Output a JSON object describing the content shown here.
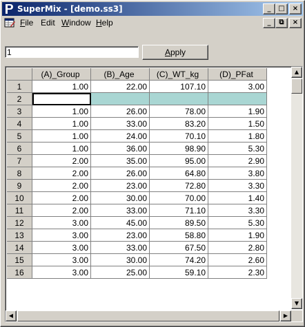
{
  "window": {
    "title": "SuperMix - [demo.ss3]",
    "controls": {
      "minimize": "_",
      "maximize": "□",
      "close": "×"
    }
  },
  "menu": {
    "items": [
      {
        "label": "File",
        "mnemonic": "F"
      },
      {
        "label": "Edit"
      },
      {
        "label": "Window",
        "mnemonic": "W"
      },
      {
        "label": "Help",
        "mnemonic": "H"
      }
    ],
    "mdi_controls": {
      "minimize": "_",
      "restore": "⧉",
      "close": "×"
    }
  },
  "toolbar": {
    "cell_value": "1",
    "apply_label": "Apply",
    "apply_mnemonic": "A"
  },
  "grid": {
    "columns": [
      "(A)_Group",
      "(B)_Age",
      "(C)_WT_kg",
      "(D)_PFat"
    ],
    "selected_row": 2,
    "rows": [
      {
        "n": "1",
        "cells": [
          "1.00",
          "22.00",
          "107.10",
          "3.00"
        ]
      },
      {
        "n": "2",
        "cells": [
          "",
          "",
          "",
          ""
        ]
      },
      {
        "n": "3",
        "cells": [
          "1.00",
          "26.00",
          "78.00",
          "1.90"
        ]
      },
      {
        "n": "4",
        "cells": [
          "1.00",
          "33.00",
          "83.20",
          "1.50"
        ]
      },
      {
        "n": "5",
        "cells": [
          "1.00",
          "24.00",
          "70.10",
          "1.80"
        ]
      },
      {
        "n": "6",
        "cells": [
          "1.00",
          "36.00",
          "98.90",
          "5.30"
        ]
      },
      {
        "n": "7",
        "cells": [
          "2.00",
          "35.00",
          "95.00",
          "2.90"
        ]
      },
      {
        "n": "8",
        "cells": [
          "2.00",
          "26.00",
          "64.80",
          "3.80"
        ]
      },
      {
        "n": "9",
        "cells": [
          "2.00",
          "23.00",
          "72.80",
          "3.30"
        ]
      },
      {
        "n": "10",
        "cells": [
          "2.00",
          "30.00",
          "70.00",
          "1.40"
        ]
      },
      {
        "n": "11",
        "cells": [
          "2.00",
          "33.00",
          "71.10",
          "3.30"
        ]
      },
      {
        "n": "12",
        "cells": [
          "3.00",
          "45.00",
          "89.50",
          "5.30"
        ]
      },
      {
        "n": "13",
        "cells": [
          "3.00",
          "23.00",
          "58.80",
          "1.90"
        ]
      },
      {
        "n": "14",
        "cells": [
          "3.00",
          "33.00",
          "67.50",
          "2.80"
        ]
      },
      {
        "n": "15",
        "cells": [
          "3.00",
          "30.00",
          "74.20",
          "2.60"
        ]
      },
      {
        "n": "16",
        "cells": [
          "3.00",
          "25.00",
          "59.10",
          "2.30"
        ]
      }
    ]
  },
  "colors": {
    "title_start": "#0a246a",
    "title_end": "#a6caf0",
    "selected_row": "#a9d6d3",
    "face": "#d4d0c8"
  },
  "icons": {
    "app": "supermix-app-icon",
    "doc": "spreadsheet-doc-icon"
  }
}
